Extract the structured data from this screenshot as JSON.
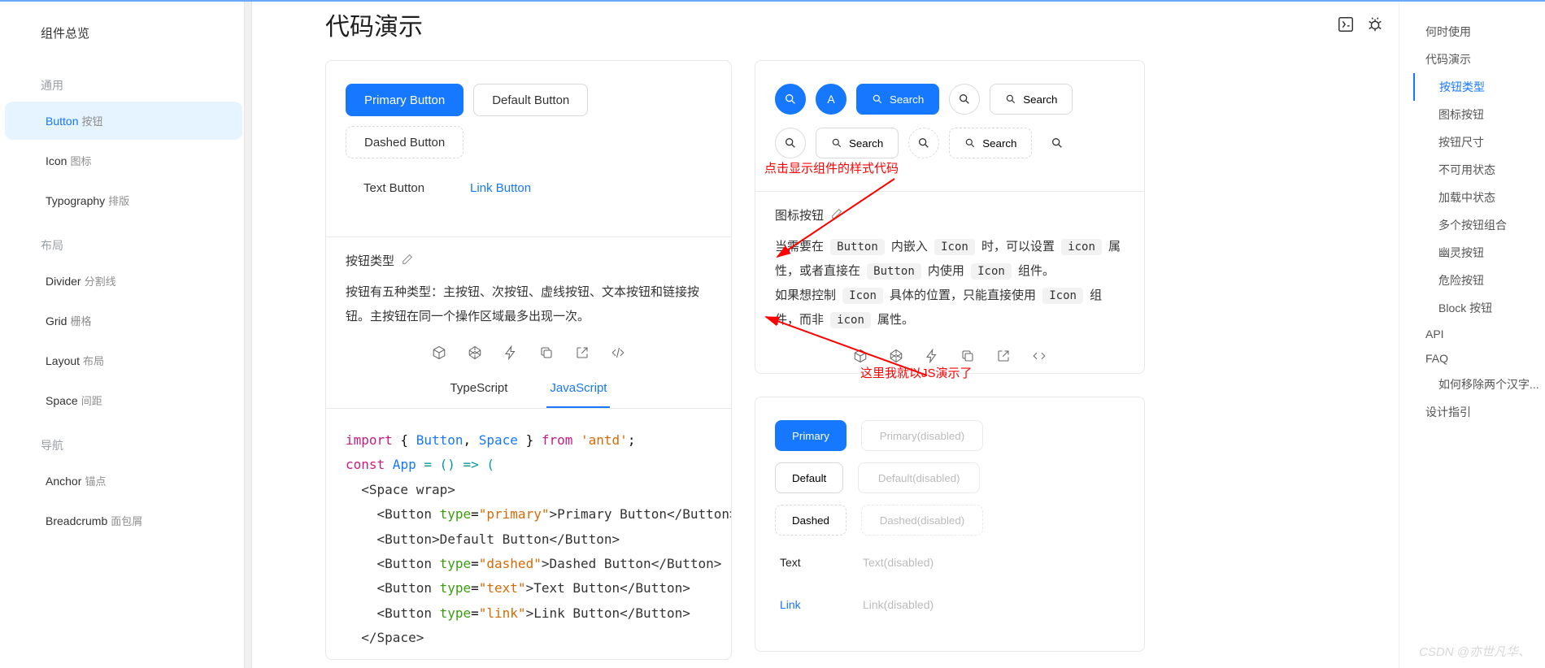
{
  "sidebar": {
    "title": "组件总览",
    "groups": [
      {
        "label": "通用",
        "items": [
          {
            "name": "Button",
            "sub": "按钮",
            "active": true
          },
          {
            "name": "Icon",
            "sub": "图标"
          },
          {
            "name": "Typography",
            "sub": "排版"
          }
        ]
      },
      {
        "label": "布局",
        "items": [
          {
            "name": "Divider",
            "sub": "分割线"
          },
          {
            "name": "Grid",
            "sub": "栅格"
          },
          {
            "name": "Layout",
            "sub": "布局"
          },
          {
            "name": "Space",
            "sub": "间距"
          }
        ]
      },
      {
        "label": "导航",
        "items": [
          {
            "name": "Anchor",
            "sub": "锚点"
          },
          {
            "name": "Breadcrumb",
            "sub": "面包屑"
          }
        ]
      }
    ]
  },
  "page": {
    "title": "代码演示"
  },
  "demo1": {
    "buttons": {
      "primary": "Primary Button",
      "default": "Default Button",
      "dashed": "Dashed Button",
      "text": "Text Button",
      "link": "Link Button"
    },
    "meta_title": "按钮类型",
    "meta_desc": "按钮有五种类型：主按钮、次按钮、虚线按钮、文本按钮和链接按钮。主按钮在同一个操作区域最多出现一次。",
    "tabs": {
      "ts": "TypeScript",
      "js": "JavaScript"
    }
  },
  "code": {
    "l1_import": "import",
    "l1_brace_o": " { ",
    "l1_btn": "Button",
    "l1_comma": ", ",
    "l1_space": "Space",
    "l1_brace_c": " } ",
    "l1_from": "from",
    "l1_pkg": "'antd'",
    "l1_semi": ";",
    "l2_const": "const",
    "l2_app": " App ",
    "l2_eq": "= () => (",
    "l3": "  <Space wrap>",
    "l4a": "    <Button ",
    "l4k": "type",
    "l4e": "=",
    "l4v": "\"primary\"",
    "l4c": ">Primary Button</Button>",
    "l5": "    <Button>Default Button</Button>",
    "l6a": "    <Button ",
    "l6v": "\"dashed\"",
    "l6c": ">Dashed Button</Button>",
    "l7a": "    <Button ",
    "l7v": "\"text\"",
    "l7c": ">Text Button</Button>",
    "l8a": "    <Button ",
    "l8v": "\"link\"",
    "l8c": ">Link Button</Button>",
    "l9": "  </Space>"
  },
  "demo2": {
    "search_label": "Search",
    "letter": "A",
    "meta_title": "图标按钮",
    "desc_parts": {
      "p1": "当需要在 ",
      "c1": "Button",
      "p2": " 内嵌入 ",
      "c2": "Icon",
      "p3": " 时，可以设置 ",
      "c3": "icon",
      "p4": " 属性，或者直接在 ",
      "c4": "Button",
      "p5": " 内使用 ",
      "c5": "Icon",
      "p6": " 组件。",
      "p7": "如果想控制 ",
      "c6": "Icon",
      "p8": " 具体的位置，只能直接使用 ",
      "c7": "Icon",
      "p9": " 组件，而非 ",
      "c8": "icon",
      "p10": " 属性。"
    }
  },
  "demo3": {
    "rows": [
      {
        "label": "Primary",
        "dis": "Primary(disabled)",
        "type": "primary"
      },
      {
        "label": "Default",
        "dis": "Default(disabled)",
        "type": "default"
      },
      {
        "label": "Dashed",
        "dis": "Dashed(disabled)",
        "type": "dashed"
      },
      {
        "label": "Text",
        "dis": "Text(disabled)",
        "type": "text"
      },
      {
        "label": "Link",
        "dis": "Link(disabled)",
        "type": "link"
      }
    ]
  },
  "annotations": {
    "a1": "点击显示组件的样式代码",
    "a2": "这里我就以JS演示了"
  },
  "anchor": [
    {
      "label": "何时使用",
      "lv": 1
    },
    {
      "label": "代码演示",
      "lv": 1
    },
    {
      "label": "按钮类型",
      "lv": 2,
      "active": true
    },
    {
      "label": "图标按钮",
      "lv": 2
    },
    {
      "label": "按钮尺寸",
      "lv": 2
    },
    {
      "label": "不可用状态",
      "lv": 2
    },
    {
      "label": "加载中状态",
      "lv": 2
    },
    {
      "label": "多个按钮组合",
      "lv": 2
    },
    {
      "label": "幽灵按钮",
      "lv": 2
    },
    {
      "label": "危险按钮",
      "lv": 2
    },
    {
      "label": "Block 按钮",
      "lv": 2
    },
    {
      "label": "API",
      "lv": 1
    },
    {
      "label": "FAQ",
      "lv": 1
    },
    {
      "label": "如何移除两个汉字...",
      "lv": 2
    },
    {
      "label": "设计指引",
      "lv": 1
    }
  ],
  "watermark": "CSDN @亦世凡华、"
}
